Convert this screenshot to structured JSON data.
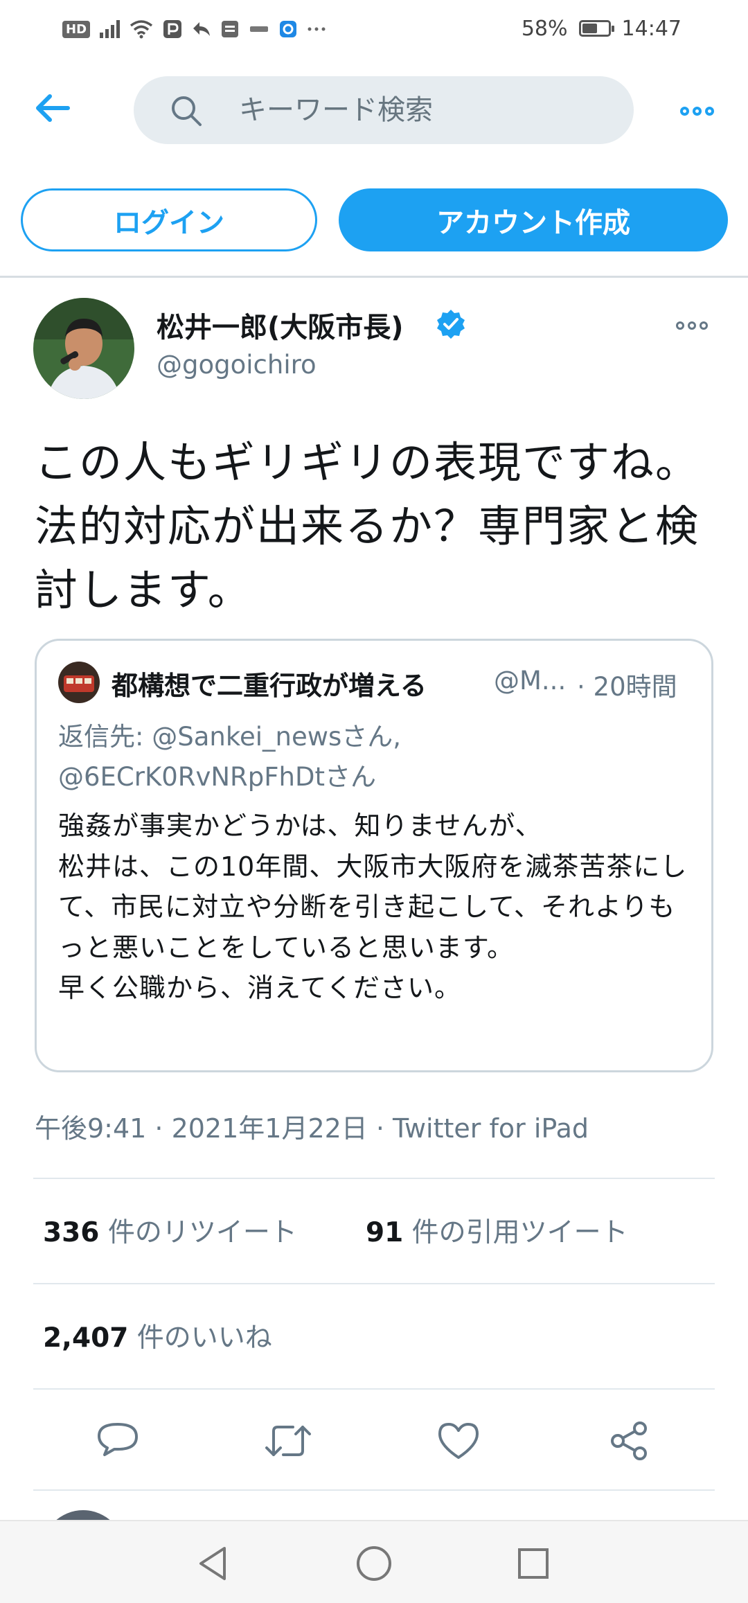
{
  "status_bar": {
    "hd_badge": "HD",
    "battery_percent": "58%",
    "battery_level": 0.58,
    "time": "14:47"
  },
  "header": {
    "back_icon": "arrow-left-icon",
    "search_placeholder": "キーワード検索",
    "more_icon": "more-horizontal-icon"
  },
  "auth": {
    "login_label": "ログイン",
    "signup_label": "アカウント作成"
  },
  "tweet": {
    "author_name": "松井一郎(大阪市長)",
    "author_handle": "@gogoichiro",
    "verified": true,
    "text": "この人もギリギリの表現ですね。法的対応が出来るか？専門家と検討します。",
    "quoted": {
      "name": "都構想で二重行政が増える",
      "handle": "@M...",
      "time": "· 20時間",
      "reply_to_prefix": "返信先:",
      "reply_to_1": "@Sankei_newsさん,",
      "reply_to_2": "@6ECrK0RvNRpFhDtさん",
      "body": "強姦が事実かどうかは、知りませんが、\n松井は、この10年間、大阪市大阪府を滅茶苦茶にして、市民に対立や分断を引き起こして、それよりもっと悪いことをしていると思います。\n早く公職から、消えてください。"
    },
    "meta": "午後9:41 · 2021年1月22日 · Twitter for iPad",
    "retweets_count": "336",
    "retweets_label": " 件のリツイート",
    "quotes_count": "91",
    "quotes_label": " 件の引用ツイート",
    "likes_count": "2,407",
    "likes_label": " 件のいいね"
  },
  "actions": {
    "reply_icon": "reply-icon",
    "retweet_icon": "retweet-icon",
    "like_icon": "heart-icon",
    "share_icon": "share-icon"
  },
  "colors": {
    "accent": "#1da1f2",
    "text_secondary": "#657786",
    "search_bg": "#e6ecf0",
    "border": "#ccd6dd"
  }
}
